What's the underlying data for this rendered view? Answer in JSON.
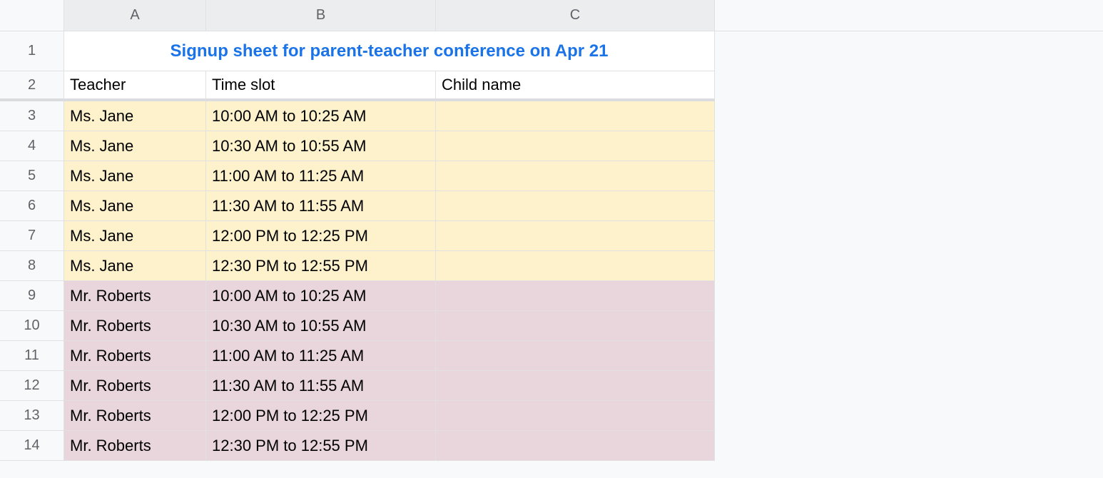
{
  "columns": [
    "A",
    "B",
    "C"
  ],
  "title": "Signup sheet for parent-teacher conference on Apr 21",
  "headers": {
    "teacher": "Teacher",
    "timeslot": "Time slot",
    "childname": "Child name"
  },
  "rowNumbers": [
    "1",
    "2",
    "3",
    "4",
    "5",
    "6",
    "7",
    "8",
    "9",
    "10",
    "11",
    "12",
    "13",
    "14"
  ],
  "rows": [
    {
      "teacher": "Ms. Jane",
      "timeslot": "10:00 AM to 10:25 AM",
      "childname": "",
      "color": "yellow"
    },
    {
      "teacher": "Ms. Jane",
      "timeslot": "10:30 AM to 10:55 AM",
      "childname": "",
      "color": "yellow"
    },
    {
      "teacher": "Ms. Jane",
      "timeslot": "11:00 AM to 11:25 AM",
      "childname": "",
      "color": "yellow"
    },
    {
      "teacher": "Ms. Jane",
      "timeslot": "11:30 AM to 11:55 AM",
      "childname": "",
      "color": "yellow"
    },
    {
      "teacher": "Ms. Jane",
      "timeslot": "12:00 PM to 12:25 PM",
      "childname": "",
      "color": "yellow"
    },
    {
      "teacher": "Ms. Jane",
      "timeslot": "12:30 PM to 12:55 PM",
      "childname": "",
      "color": "yellow"
    },
    {
      "teacher": "Mr. Roberts",
      "timeslot": "10:00 AM to 10:25 AM",
      "childname": "",
      "color": "pink"
    },
    {
      "teacher": "Mr. Roberts",
      "timeslot": "10:30 AM to 10:55 AM",
      "childname": "",
      "color": "pink"
    },
    {
      "teacher": "Mr. Roberts",
      "timeslot": "11:00 AM to 11:25 AM",
      "childname": "",
      "color": "pink"
    },
    {
      "teacher": "Mr. Roberts",
      "timeslot": "11:30 AM to 11:55 AM",
      "childname": "",
      "color": "pink"
    },
    {
      "teacher": "Mr. Roberts",
      "timeslot": "12:00 PM to 12:25 PM",
      "childname": "",
      "color": "pink"
    },
    {
      "teacher": "Mr. Roberts",
      "timeslot": "12:30 PM to 12:55 PM",
      "childname": "",
      "color": "pink"
    }
  ]
}
